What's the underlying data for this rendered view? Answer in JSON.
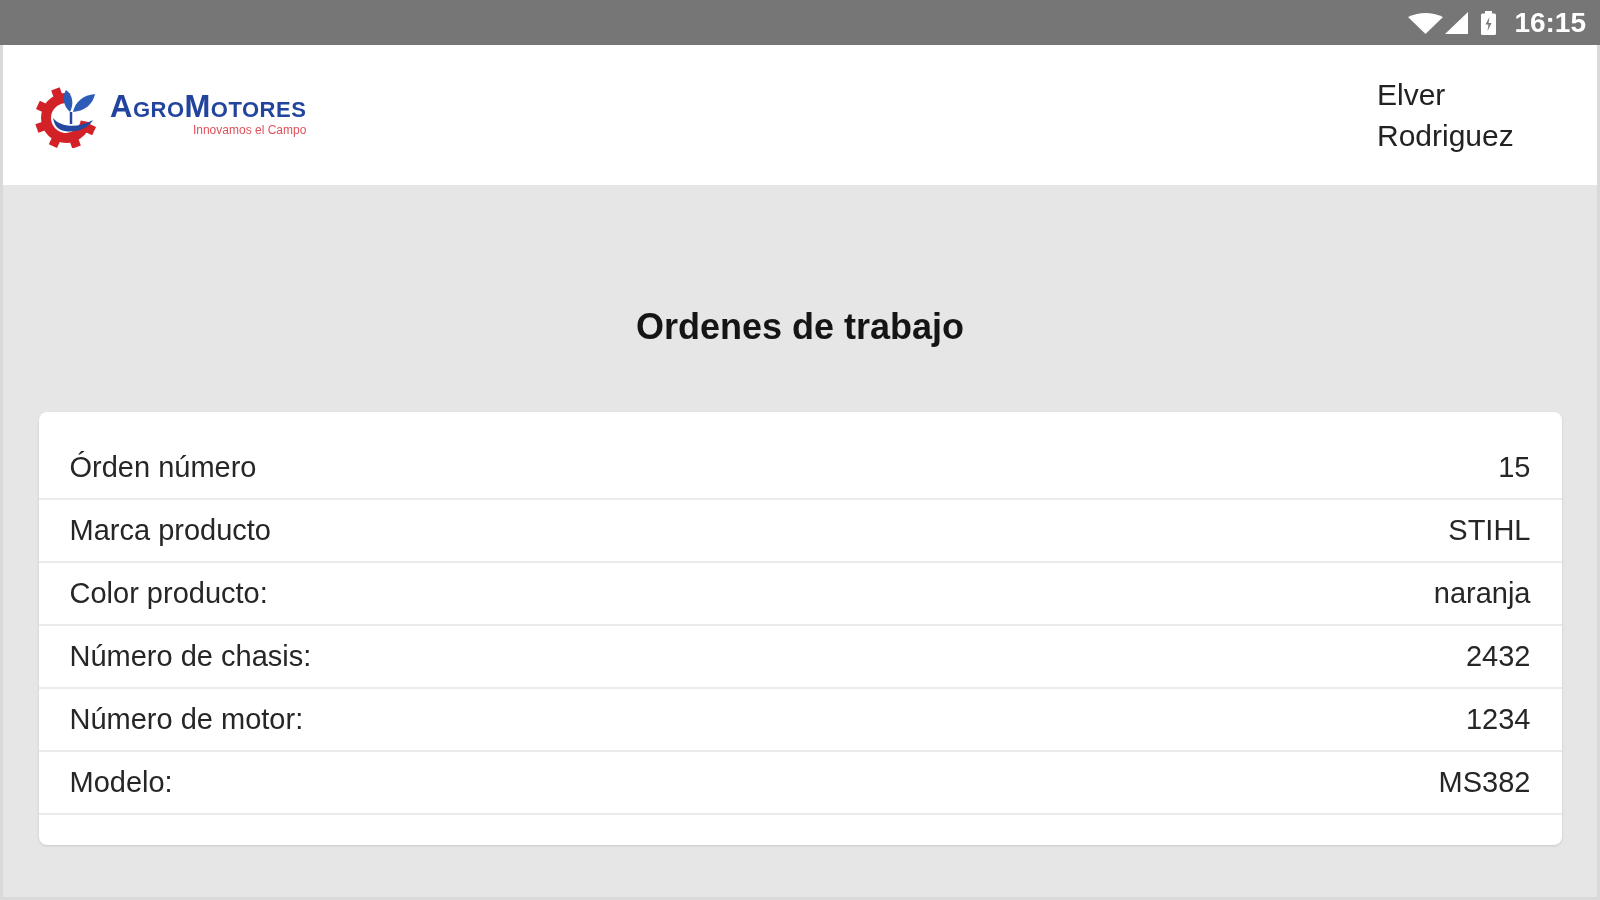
{
  "status_bar": {
    "time": "16:15"
  },
  "header": {
    "logo": {
      "name": "AgroMotores",
      "tagline": "Innovamos el Campo"
    },
    "user": "Elver Rodriguez"
  },
  "title": "Ordenes de trabajo",
  "details": [
    {
      "label": "Órden número",
      "value": "15"
    },
    {
      "label": "Marca producto",
      "value": "STIHL"
    },
    {
      "label": "Color producto:",
      "value": "naranja"
    },
    {
      "label": "Número de chasis:",
      "value": "2432"
    },
    {
      "label": "Número de motor:",
      "value": "1234"
    },
    {
      "label": "Modelo:",
      "value": "MS382"
    }
  ]
}
